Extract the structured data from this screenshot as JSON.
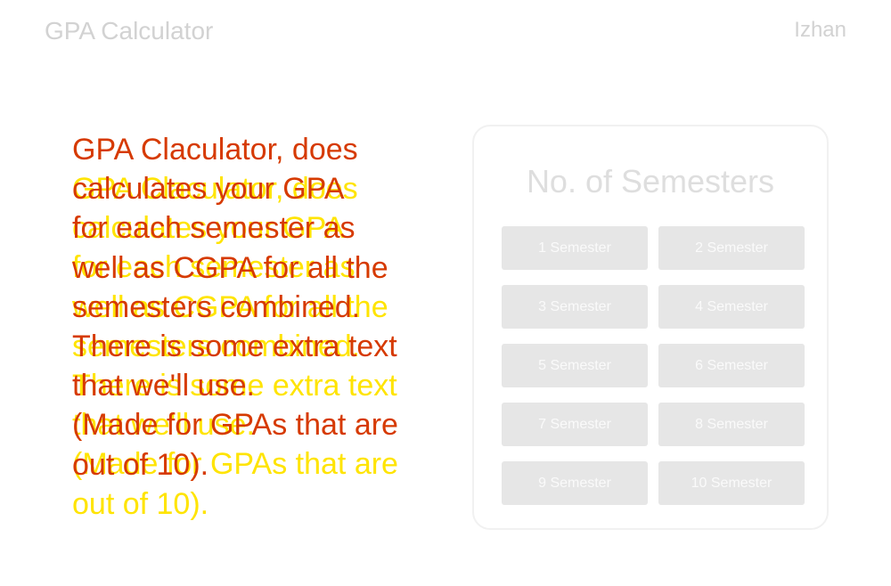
{
  "header": {
    "brand": "GPA Calculator",
    "user": "Izhan"
  },
  "hero": {
    "front_lines": [
      "GPA Claculator, does",
      "calculates your GPA",
      "for each semester as",
      "well as CGPA for all the",
      "semesters combined.",
      "There is some extra text",
      "that we'll use.",
      "(Made for GPAs that are",
      "out of 10)."
    ],
    "back_lines": [
      "GPA Claculator, does",
      "calculates your GPA",
      "for each semester as",
      "well as CGPA for all the",
      "semesters combined.",
      "There is some extra text",
      "that we'll use.",
      "(Made for GPAs that are",
      "out of 10)."
    ]
  },
  "panel": {
    "title": "No. of Semesters",
    "buttons": [
      "1 Semester",
      "2 Semester",
      "3 Semester",
      "4 Semester",
      "5 Semester",
      "6 Semester",
      "7 Semester",
      "8 Semester",
      "9 Semester",
      "10 Semester"
    ]
  },
  "colors": {
    "hero_front": "#d63a00",
    "hero_back": "#ffe400",
    "button_bg": "#e6e6e6",
    "muted_text": "#d2d2d2"
  }
}
